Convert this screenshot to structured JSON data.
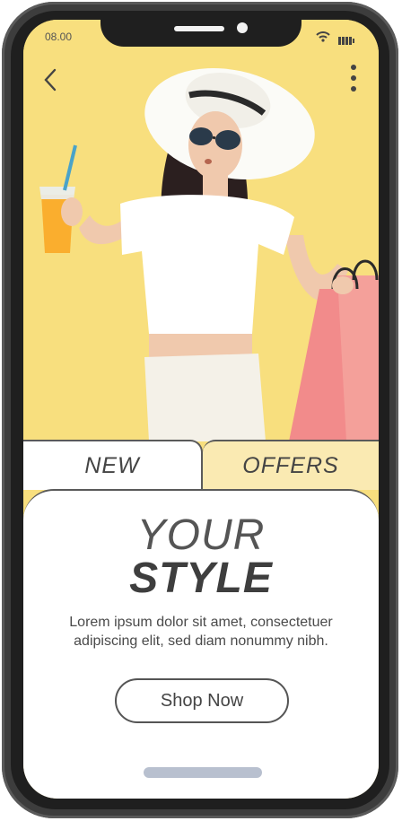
{
  "status_bar": {
    "time": "08.00"
  },
  "tabs": {
    "new": "NEW",
    "offers": "OFFERS"
  },
  "hero": {
    "line1": "YOUR",
    "line2": "STYLE"
  },
  "description": "Lorem ipsum dolor sit amet, consectetuer adipiscing elit, sed diam nonummy nibh.",
  "cta": {
    "label": "Shop Now"
  },
  "icons": {
    "back": "chevron-left-icon",
    "more": "vertical-dots-icon",
    "wifi": "wifi-icon",
    "battery": "battery-icon"
  },
  "colors": {
    "background_yellow": "#f8df7e",
    "offers_tab": "#faeab2",
    "frame": "#3d3d3d",
    "bag_pink": "#f28b8b",
    "home_indicator": "#b8c0cf"
  }
}
